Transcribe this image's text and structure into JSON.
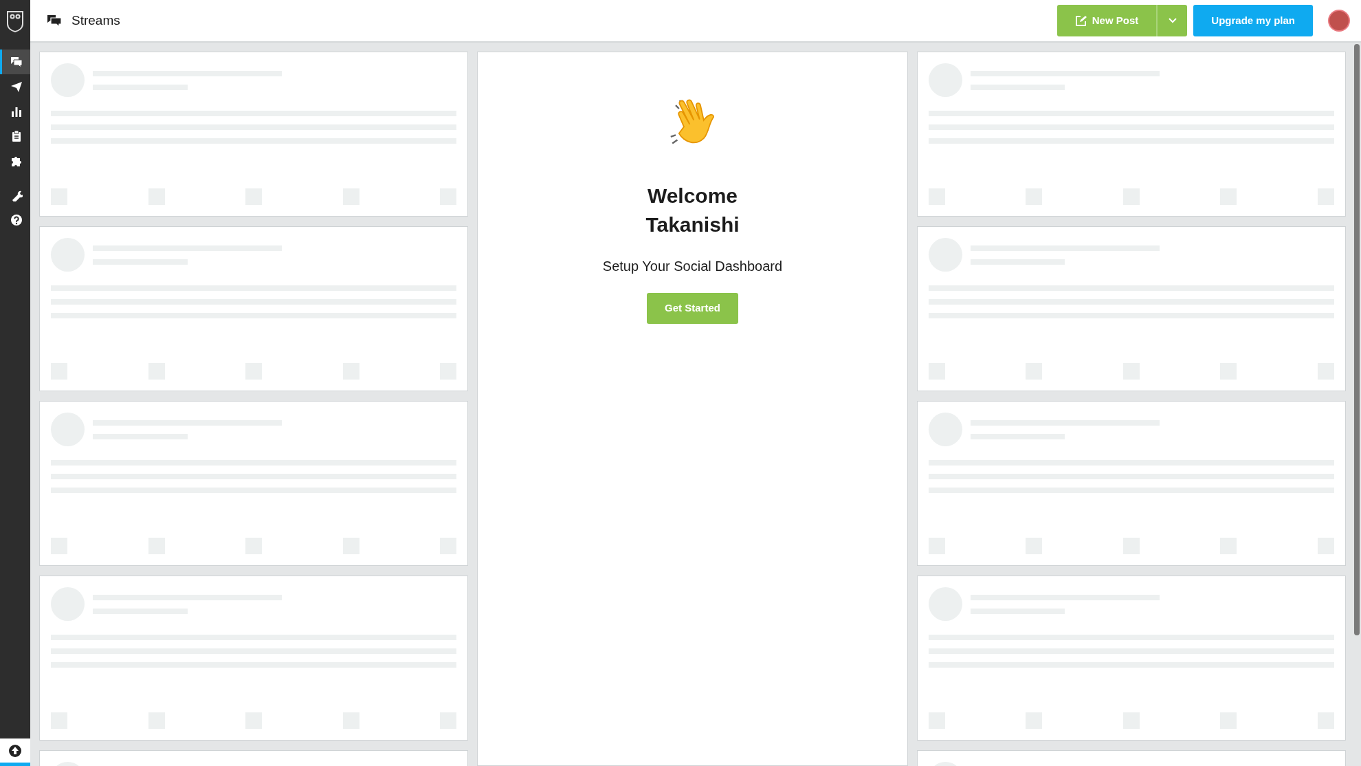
{
  "sidebar": {
    "items": [
      {
        "selected": true
      },
      {
        "selected": false
      },
      {
        "selected": false
      },
      {
        "selected": false
      },
      {
        "selected": false
      },
      {
        "selected": false
      },
      {
        "selected": false
      }
    ]
  },
  "header": {
    "title": "Streams"
  },
  "actions": {
    "new_post": "New Post",
    "upgrade": "Upgrade my plan"
  },
  "welcome": {
    "heading": "Welcome Takanishi",
    "subtitle": "Setup Your Social Dashboard",
    "button": "Get Started"
  }
}
